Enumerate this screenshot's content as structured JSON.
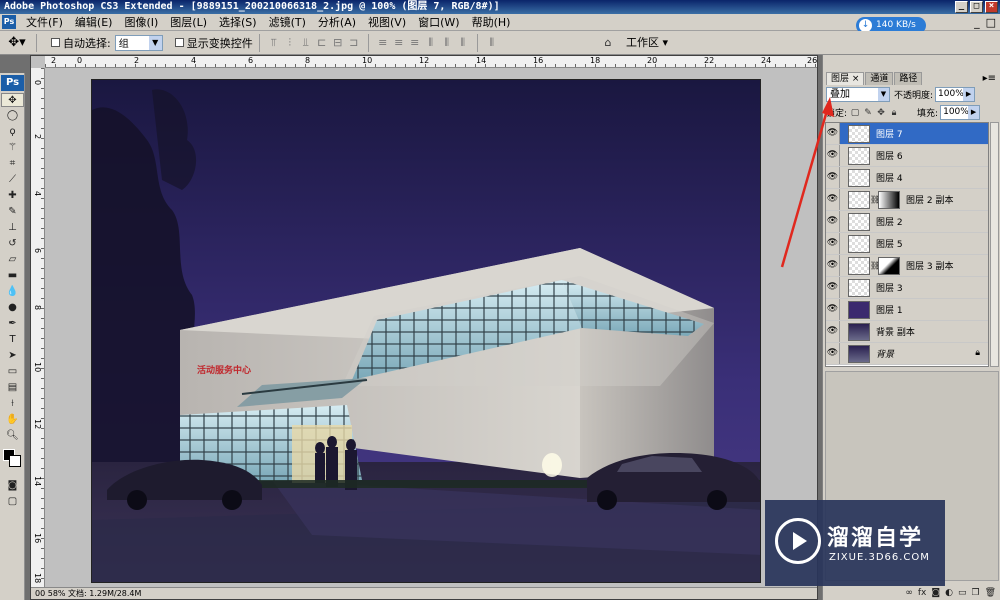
{
  "window": {
    "title": "Adobe Photoshop CS3 Extended - [9889151_200210066318_2.jpg @ 100% (图层 7, RGB/8#)]",
    "controls": [
      "_",
      "□",
      "×"
    ]
  },
  "menubar": {
    "app_badge": "Ps",
    "items": [
      "文件(F)",
      "编辑(E)",
      "图像(I)",
      "图层(L)",
      "选择(S)",
      "滤镜(T)",
      "分析(A)",
      "视图(V)",
      "窗口(W)",
      "帮助(H)"
    ],
    "net_speed": "140 KB/s",
    "mdi_controls": [
      "_",
      "□"
    ]
  },
  "options": {
    "auto_select_label": "自动选择:",
    "auto_select_value": "组",
    "show_transform_label": "显示变换控件",
    "workspace_label": "工作区 ▾"
  },
  "toolbox": {
    "logo": "Ps"
  },
  "document": {
    "ruler_top": [
      "2",
      "0",
      "2",
      "4",
      "6",
      "8",
      "10",
      "12",
      "14",
      "16",
      "18",
      "20",
      "22",
      "24",
      "26"
    ],
    "ruler_left": [
      "0",
      "2",
      "4",
      "6",
      "8",
      "10",
      "12",
      "14",
      "16",
      "18"
    ],
    "status": "00 58%    文档: 1.29M/28.4M"
  },
  "image": {
    "sign_text": "活动服务中心"
  },
  "panel": {
    "tabs": [
      "图层 ×",
      "通道",
      "路径"
    ],
    "blend_mode": "叠加",
    "opacity_label": "不透明度:",
    "opacity_value": "100%",
    "lock_label": "锁定:",
    "fill_label": "填充:",
    "fill_value": "100%",
    "layers": [
      {
        "name": "图层 7",
        "selected": true,
        "thumb": "transparent",
        "mask": false
      },
      {
        "name": "图层 6",
        "selected": false,
        "thumb": "transparent",
        "mask": false
      },
      {
        "name": "图层 4",
        "selected": false,
        "thumb": "transparent",
        "mask": false
      },
      {
        "name": "图层 2 副本",
        "selected": false,
        "thumb": "transparent",
        "mask": true
      },
      {
        "name": "图层 2",
        "selected": false,
        "thumb": "transparent",
        "mask": false
      },
      {
        "name": "图层 5",
        "selected": false,
        "thumb": "transparent",
        "mask": false
      },
      {
        "name": "图层 3 副本",
        "selected": false,
        "thumb": "transparent",
        "mask": true
      },
      {
        "name": "图层 3",
        "selected": false,
        "thumb": "transparent",
        "mask": false
      },
      {
        "name": "图层 1",
        "selected": false,
        "thumb": "purple",
        "mask": false
      },
      {
        "name": "背景 副本",
        "selected": false,
        "thumb": "night",
        "mask": false
      },
      {
        "name": "背景",
        "selected": false,
        "thumb": "night",
        "mask": false,
        "locked": true,
        "italic": true
      }
    ],
    "bottom_icons": [
      "link-icon",
      "fx-icon",
      "mask-icon",
      "adjustment-icon",
      "group-icon",
      "new-layer-icon",
      "trash-icon"
    ]
  },
  "watermark": {
    "title": "溜溜自学",
    "url": "ZIXUE.3D66.COM"
  },
  "colors": {
    "selection": "#316ac5",
    "chrome": "#d4d0c8",
    "arrow": "#e0281e",
    "sky_top": "#1a1740",
    "sky_bottom": "#4a3c86"
  }
}
